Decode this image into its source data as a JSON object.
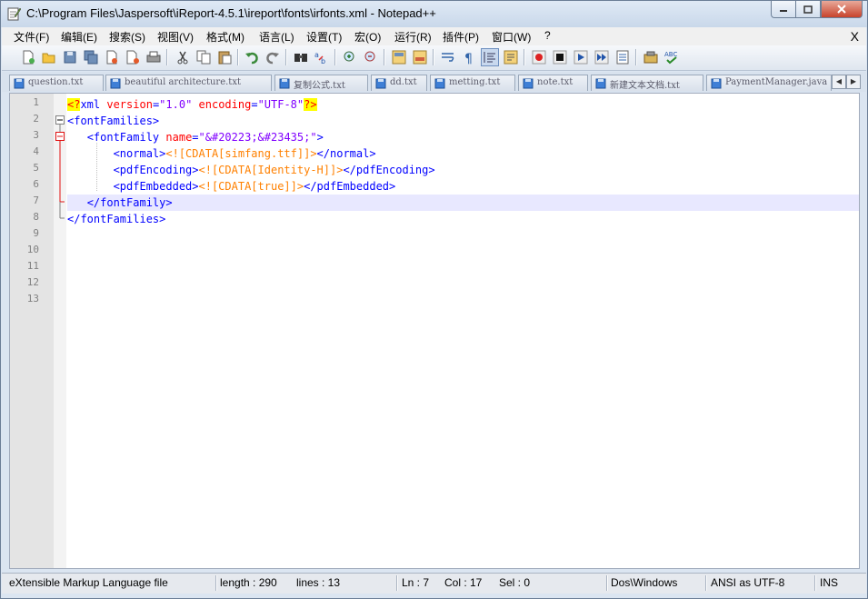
{
  "window": {
    "title": "C:\\Program Files\\Jaspersoft\\iReport-4.5.1\\ireport\\fonts\\irfonts.xml - Notepad++"
  },
  "menu": {
    "items": [
      "文件(F)",
      "编辑(E)",
      "搜索(S)",
      "视图(V)",
      "格式(M)",
      "语言(L)",
      "设置(T)",
      "宏(O)",
      "运行(R)",
      "插件(P)",
      "窗口(W)",
      "?"
    ],
    "close_label": "X"
  },
  "toolbar": {
    "icons": [
      "new-file-icon",
      "open-file-icon",
      "save-icon",
      "save-all-icon",
      "close-icon",
      "close-all-icon",
      "print-icon",
      "cut-icon",
      "copy-icon",
      "paste-icon",
      "undo-icon",
      "redo-icon",
      "find-icon",
      "replace-icon",
      "zoom-in-icon",
      "zoom-out-icon",
      "sync-v-icon",
      "sync-h-icon",
      "wrap-icon",
      "show-all-chars-icon",
      "indent-guide-icon",
      "doc-map-icon",
      "record-macro-icon",
      "stop-macro-icon",
      "play-macro-icon",
      "run-macro-multiple-icon",
      "save-macro-icon",
      "plugin-icon",
      "spellcheck-icon"
    ]
  },
  "tabs": [
    {
      "label": "question.txt",
      "active": false
    },
    {
      "label": "beautiful architecture.txt",
      "active": false
    },
    {
      "label": "复制公式.txt",
      "active": false
    },
    {
      "label": "dd.txt",
      "active": false
    },
    {
      "label": "metting.txt",
      "active": false
    },
    {
      "label": "note.txt",
      "active": false
    },
    {
      "label": "新建文本文档.txt",
      "active": false
    },
    {
      "label": "PaymentManager.java",
      "active": false
    }
  ],
  "editor": {
    "line_numbers": [
      "1",
      "2",
      "3",
      "4",
      "5",
      "6",
      "7",
      "8",
      "9",
      "10",
      "11",
      "12",
      "13"
    ],
    "current_line": 7,
    "lines": [
      {
        "indent": "",
        "parts": [
          [
            "decl",
            "<?"
          ],
          [
            "tag",
            "xml "
          ],
          [
            "attr",
            "version"
          ],
          [
            "tag",
            "="
          ],
          [
            "val",
            "\"1.0\" "
          ],
          [
            "attr",
            "encoding"
          ],
          [
            "tag",
            "="
          ],
          [
            "val",
            "\"UTF-8\""
          ],
          [
            "decl",
            "?>"
          ]
        ]
      },
      {
        "indent": "",
        "parts": [
          [
            "tag",
            "<fontFamilies>"
          ]
        ]
      },
      {
        "indent": "   ",
        "parts": [
          [
            "tag",
            "<fontFamily "
          ],
          [
            "attr",
            "name"
          ],
          [
            "tag",
            "="
          ],
          [
            "val",
            "\"&#20223;&#23435;\""
          ],
          [
            "tag",
            ">"
          ]
        ]
      },
      {
        "indent": "       ",
        "parts": [
          [
            "tag",
            "<normal>"
          ],
          [
            "cdata",
            "<![CDATA[simfang.ttf]]>"
          ],
          [
            "tag",
            "</normal>"
          ]
        ]
      },
      {
        "indent": "       ",
        "parts": [
          [
            "tag",
            "<pdfEncoding>"
          ],
          [
            "cdata",
            "<![CDATA[Identity-H]]>"
          ],
          [
            "tag",
            "</pdfEncoding>"
          ]
        ]
      },
      {
        "indent": "       ",
        "parts": [
          [
            "tag",
            "<pdfEmbedded>"
          ],
          [
            "cdata",
            "<![CDATA[true]]>"
          ],
          [
            "tag",
            "</pdfEmbedded>"
          ]
        ]
      },
      {
        "indent": "   ",
        "parts": [
          [
            "tag",
            "</fontFamily>"
          ]
        ]
      },
      {
        "indent": "",
        "parts": [
          [
            "tag",
            "</fontFamilies>"
          ]
        ]
      }
    ]
  },
  "status": {
    "file_type": "eXtensible Markup Language file",
    "length": "length : 290",
    "lines": "lines : 13",
    "ln": "Ln : 7",
    "col": "Col : 17",
    "sel": "Sel : 0",
    "eol": "Dos\\Windows",
    "encoding": "ANSI as UTF-8",
    "mode": "INS"
  },
  "colors": {
    "tag": "#0000ff",
    "attribute": "#ff0000",
    "value": "#8000ff",
    "cdata": "#ff8000",
    "current_line": "#e8e8ff"
  }
}
